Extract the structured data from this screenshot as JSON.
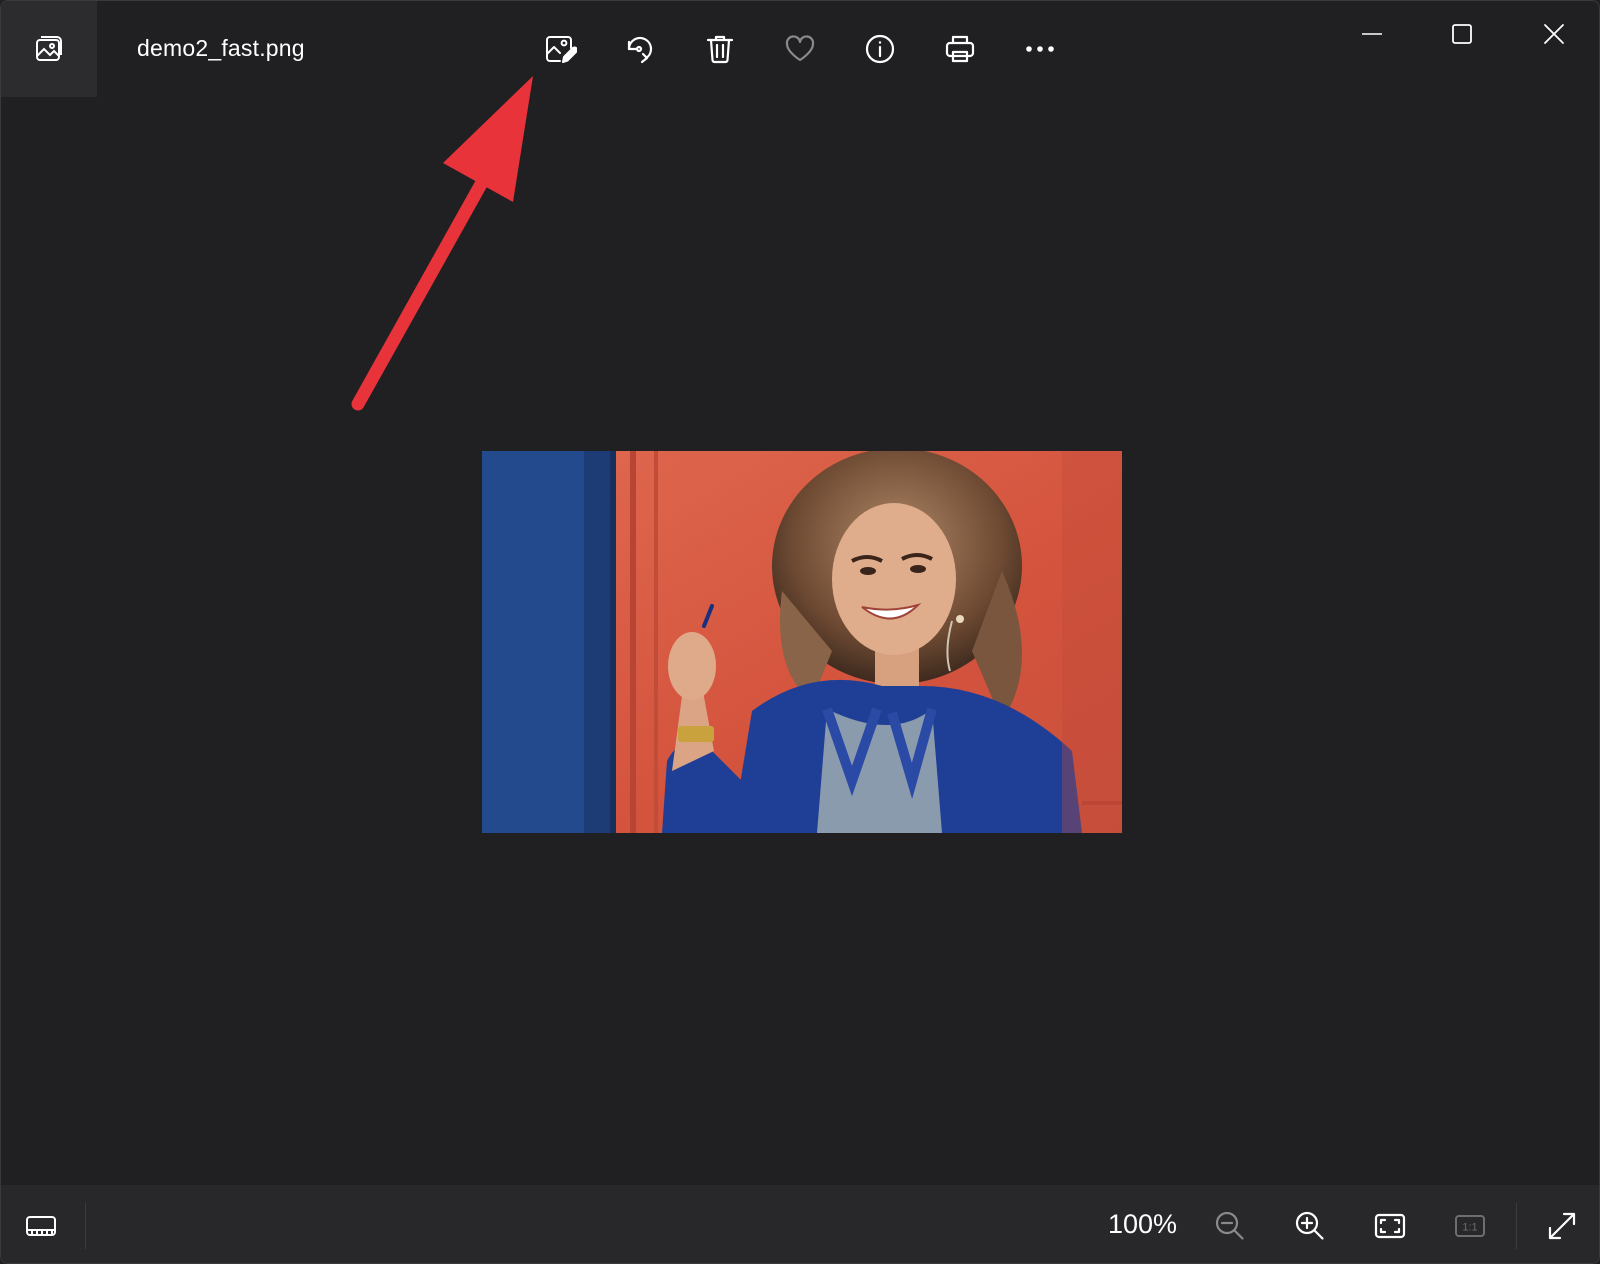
{
  "titlebar": {
    "file_name": "demo2_fast.png",
    "app_icon": "photos-app-icon",
    "toolbar": [
      {
        "name": "edit-image",
        "icon": "edit-image-icon"
      },
      {
        "name": "rotate",
        "icon": "rotate-icon"
      },
      {
        "name": "delete",
        "icon": "trash-icon"
      },
      {
        "name": "favorite",
        "icon": "heart-icon"
      },
      {
        "name": "file-info",
        "icon": "info-icon"
      },
      {
        "name": "print",
        "icon": "printer-icon"
      },
      {
        "name": "see-more",
        "icon": "more-icon"
      }
    ],
    "window_controls": [
      "minimize",
      "maximize",
      "close"
    ]
  },
  "viewer": {
    "annotation_color": "#e8333a"
  },
  "bottombar": {
    "zoom_level": "100%",
    "one_to_one_label": "1:1",
    "buttons": [
      "filmstrip",
      "zoom-out",
      "zoom-in",
      "fit-to-window",
      "actual-size",
      "full-screen"
    ]
  },
  "colors": {
    "background": "#201f22",
    "bar": "#28272a",
    "icon": "#ffffff",
    "icon_disabled": "#8a898c"
  }
}
